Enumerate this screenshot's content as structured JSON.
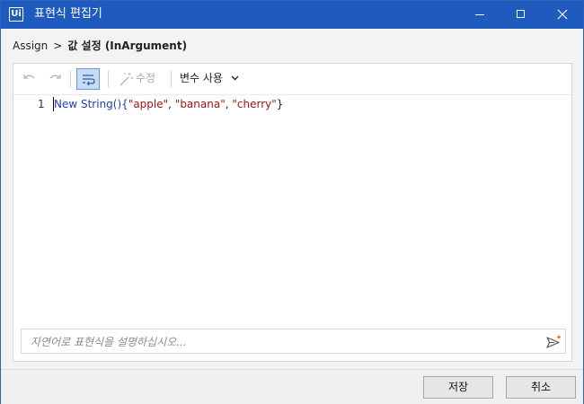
{
  "window": {
    "logo_text": "Ui",
    "title": "표현식 편집기"
  },
  "breadcrumb": {
    "parent": "Assign",
    "separator": ">",
    "current": "값 설정 (InArgument)"
  },
  "toolbar": {
    "undo_icon": "undo-icon",
    "redo_icon": "redo-icon",
    "wrap_icon": "word-wrap-icon",
    "fix_label": "수정",
    "vars_label": "변수 사용"
  },
  "editor": {
    "line_number": "1",
    "code_parts": {
      "keyword": "New String(){",
      "s1": "\"apple\"",
      "c1": ", ",
      "s2": "\"banana\"",
      "c2": ", ",
      "s3": "\"cherry\"",
      "close": "}"
    }
  },
  "nl_input": {
    "placeholder": "자연어로 표현식을 설명하십시오..."
  },
  "footer": {
    "save_label": "저장",
    "cancel_label": "취소"
  },
  "colors": {
    "titlebar": "#1f5bbf",
    "keyword": "#1c3fb5",
    "string": "#a31515"
  }
}
